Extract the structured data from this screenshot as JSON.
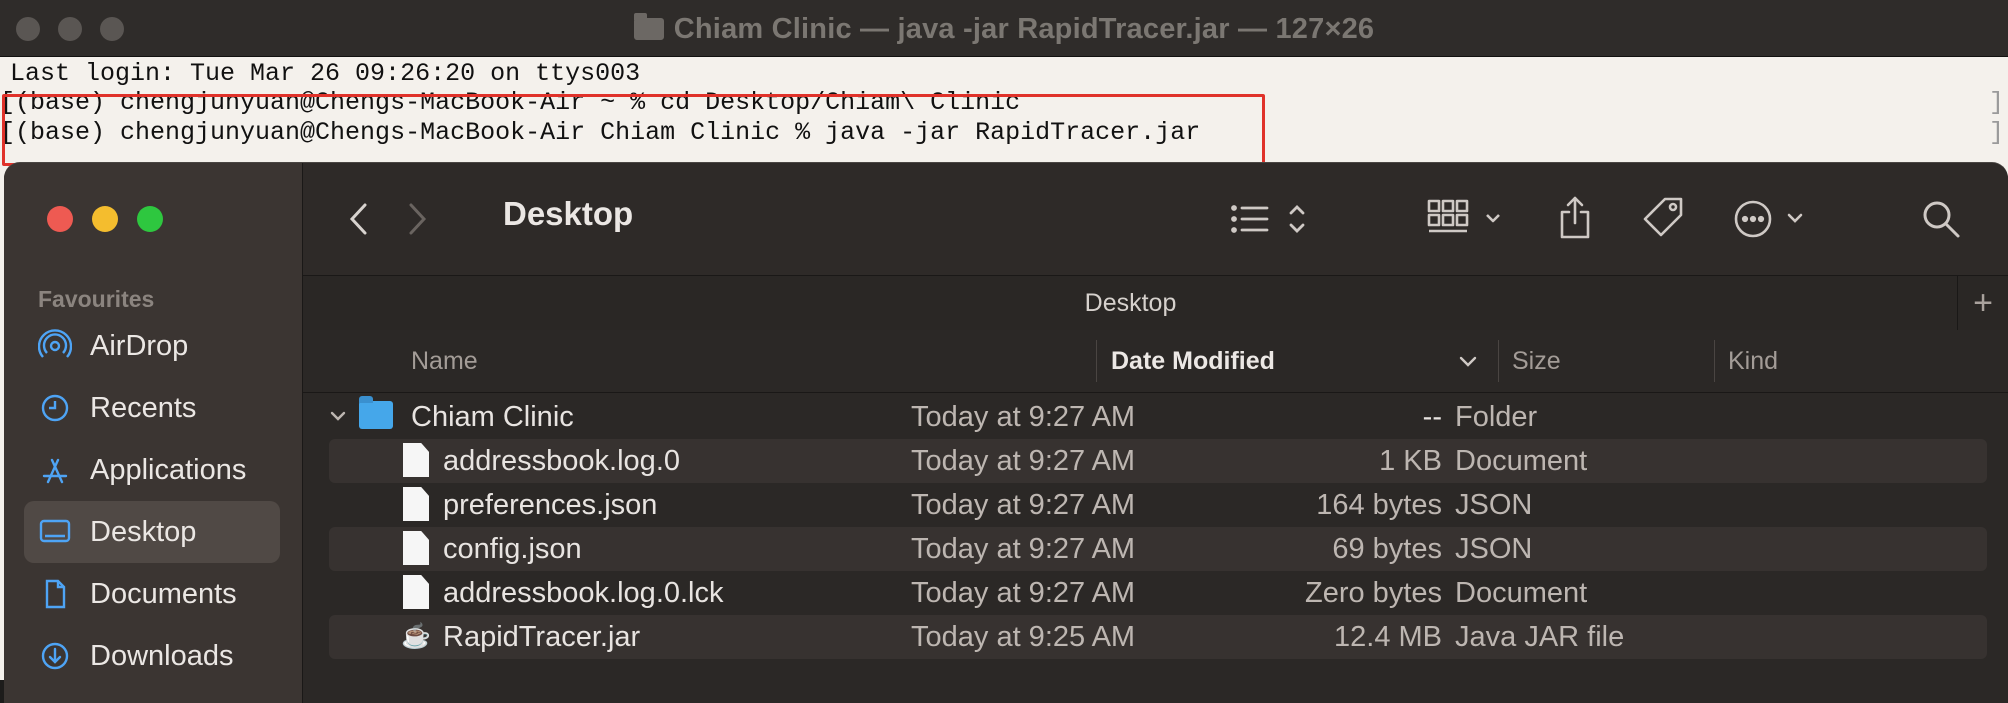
{
  "terminal": {
    "title": "Chiam Clinic — java -jar RapidTracer.jar — 127×26",
    "lines": [
      "Last login: Tue Mar 26 09:26:20 on ttys003",
      "[(base) chengjunyuan@Chengs-MacBook-Air ~ % cd Desktop/Chiam\\ Clinic",
      "[(base) chengjunyuan@Chengs-MacBook-Air Chiam Clinic % java -jar RapidTracer.jar"
    ],
    "bracket": "]",
    "highlight_color": "#e0322a"
  },
  "finder": {
    "title": "Desktop",
    "path_title": "Desktop",
    "path_plus": "+",
    "sidebar": {
      "section": "Favourites",
      "items": [
        {
          "label": "AirDrop",
          "icon": "airdrop-icon"
        },
        {
          "label": "Recents",
          "icon": "clock-icon"
        },
        {
          "label": "Applications",
          "icon": "applications-icon"
        },
        {
          "label": "Desktop",
          "icon": "desktop-icon",
          "active": true
        },
        {
          "label": "Documents",
          "icon": "document-icon"
        },
        {
          "label": "Downloads",
          "icon": "download-icon"
        }
      ]
    },
    "columns": {
      "name": "Name",
      "date": "Date Modified",
      "size": "Size",
      "kind": "Kind"
    },
    "rows": [
      {
        "name": "Chiam Clinic",
        "date": "Today at 9:27 AM",
        "size": "--",
        "kind": "Folder",
        "type": "folder"
      },
      {
        "name": "addressbook.log.0",
        "date": "Today at 9:27 AM",
        "size": "1 KB",
        "kind": "Document",
        "type": "file"
      },
      {
        "name": "preferences.json",
        "date": "Today at 9:27 AM",
        "size": "164 bytes",
        "kind": "JSON",
        "type": "file"
      },
      {
        "name": "config.json",
        "date": "Today at 9:27 AM",
        "size": "69 bytes",
        "kind": "JSON",
        "type": "file"
      },
      {
        "name": "addressbook.log.0.lck",
        "date": "Today at 9:27 AM",
        "size": "Zero bytes",
        "kind": "Document",
        "type": "file"
      },
      {
        "name": "RapidTracer.jar",
        "date": "Today at 9:25 AM",
        "size": "12.4 MB",
        "kind": "Java JAR file",
        "type": "jar"
      }
    ]
  }
}
